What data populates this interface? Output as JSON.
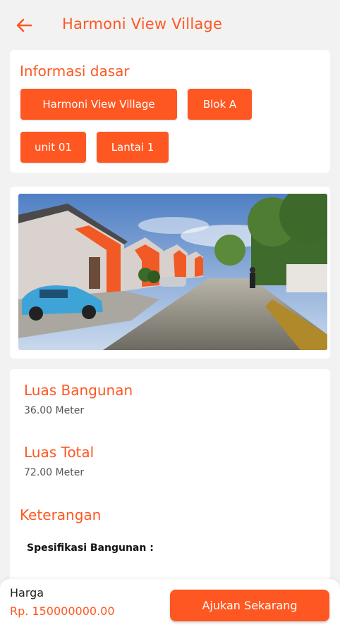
{
  "header": {
    "back_icon": "arrow-left-icon",
    "title": "Harmoni View Village"
  },
  "basic_info": {
    "title": "Informasi dasar",
    "chips": [
      "Harmoni View Village",
      "Blok A",
      "unit 01",
      "Lantai 1"
    ]
  },
  "details": {
    "luas_bangunan_label": "Luas Bangunan",
    "luas_bangunan_value": "36.00 Meter",
    "luas_total_label": "Luas Total",
    "luas_total_value": "72.00 Meter",
    "keterangan_label": "Keterangan",
    "spesifikasi_title": "Spesifikasi Bangunan :"
  },
  "bottom": {
    "price_label": "Harga",
    "price_value": "Rp. 150000000.00",
    "submit_label": "Ajukan Sekarang"
  },
  "colors": {
    "accent": "#ff5722",
    "background": "#f2f2f2",
    "card": "#ffffff"
  }
}
